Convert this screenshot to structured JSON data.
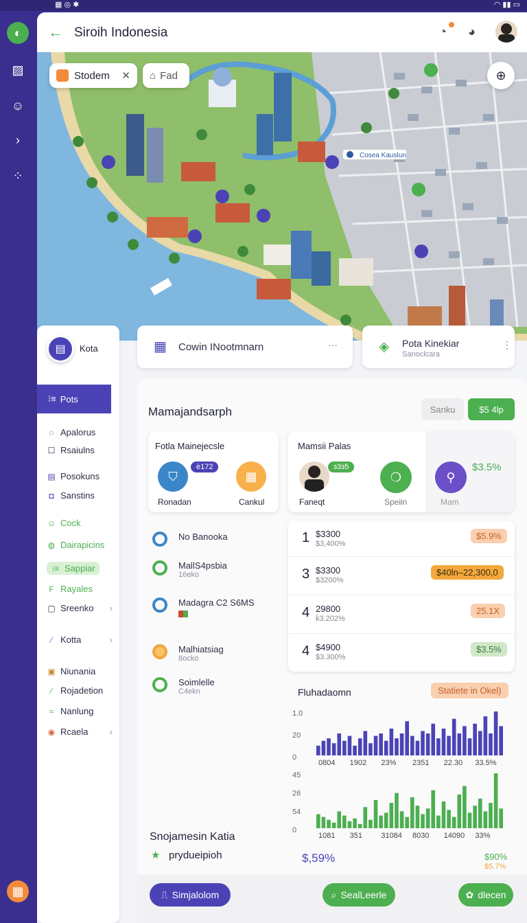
{
  "app": {
    "title": "Siroih Indonesia"
  },
  "map": {
    "search_chip": "Stodem",
    "filter_chip": "Fad",
    "label_1": "Cosea Kauslun"
  },
  "sidebar": {
    "header_label": "Kota",
    "active_item": "Pots",
    "items": [
      {
        "label": "Apalorus",
        "icon": "chat-icon"
      },
      {
        "label": "Rsaiulns",
        "icon": "edit-icon"
      },
      {
        "label": "Posokuns",
        "icon": "doc-icon"
      },
      {
        "label": "Sanstins",
        "icon": "square-icon"
      },
      {
        "label": "Cock",
        "icon": "smile-icon"
      },
      {
        "label": "Dairapicins",
        "icon": "globe-icon"
      },
      {
        "label": "Sappiar",
        "icon": "tag-icon"
      },
      {
        "label": "Rayales",
        "icon": "fz-icon"
      },
      {
        "label": "Sreenko",
        "icon": "square-icon"
      },
      {
        "label": "Kotta",
        "icon": "pen-icon"
      },
      {
        "label": "Niunania",
        "icon": "image-icon"
      },
      {
        "label": "Rojadetion",
        "icon": "leaf-icon"
      },
      {
        "label": "Nanlung",
        "icon": "wave-icon"
      },
      {
        "label": "Rcaela",
        "icon": "avatar-icon"
      }
    ]
  },
  "header_cards": {
    "left_title": "Cowin INootmnarn",
    "right_title": "Pota Kinekiar",
    "right_sub": "Sanoclcara"
  },
  "panel": {
    "title": "Mamajandsarph",
    "btn_secondary": "Sanku",
    "btn_primary": "$5 4lp",
    "card1": {
      "title": "Fotla Mainejecsle",
      "badge": "ė172",
      "item1": "Ronadan",
      "item2": "Cankul"
    },
    "card2": {
      "title": "Mamsii Palas",
      "badge": "ɜ3ɜ5",
      "item1": "Faneqt",
      "item2": "Speiin",
      "item3": "Mam",
      "value": "$3.5%"
    }
  },
  "list": [
    {
      "title": "No Banooka",
      "sub": "",
      "color": "#3a86c8"
    },
    {
      "title": "MallS4psbia",
      "sub": "16eko",
      "color": "#4caf50"
    },
    {
      "title": "Madagra C2 S6MS",
      "sub": "",
      "color": "#3a86c8"
    },
    {
      "title": "Malhiatsiag",
      "sub": "8ocko",
      "color": "#f0a640"
    },
    {
      "title": "Soimlelle",
      "sub": "C4ekn",
      "color": "#4caf50"
    }
  ],
  "ranking": [
    {
      "rank": "1",
      "value": "$3300",
      "sub": "$3,400%",
      "pill": "$5.9%",
      "pill_bg": "#f9cfae",
      "pill_color": "#c5602a"
    },
    {
      "rank": "3",
      "value": "$3300",
      "sub": "$3200%",
      "pill": "$40ln–22,300,0",
      "pill_bg": "#f2a83b",
      "pill_color": "#3b2a10"
    },
    {
      "rank": "4",
      "value": "29800",
      "sub": "ḱ3.202%",
      "pill": "25.1X",
      "pill_bg": "#f9cfae",
      "pill_color": "#c5602a"
    },
    {
      "rank": "4",
      "value": "$4900",
      "sub": "$3.300%",
      "pill": "$3.5%",
      "pill_bg": "#cfe8c8",
      "pill_color": "#3b7a3b"
    }
  ],
  "charts": {
    "title": "Fluhadaomn",
    "badge": "Statiete in Okel)",
    "footer_value_left": "$,59%",
    "footer_value_right_top": "$90%",
    "footer_value_right_bottom": "$5.7%"
  },
  "chart_data": [
    {
      "type": "bar",
      "yticks": [
        "1.0",
        "20",
        "0"
      ],
      "xticks": [
        "0804",
        "1902",
        "23%",
        "2351",
        "22.30",
        "33.5%"
      ],
      "values": [
        4,
        6,
        7,
        5,
        9,
        6,
        8,
        4,
        7,
        10,
        5,
        8,
        9,
        6,
        11,
        7,
        9,
        14,
        8,
        6,
        10,
        9,
        13,
        7,
        11,
        8,
        15,
        9,
        12,
        7,
        13,
        10,
        16,
        9,
        18,
        12
      ]
    },
    {
      "type": "bar",
      "yticks": [
        "45",
        "26",
        "54",
        "0"
      ],
      "xticks": [
        "1081",
        "351",
        "31084",
        "8030",
        "14090",
        "33%"
      ],
      "values": [
        10,
        8,
        6,
        4,
        12,
        9,
        5,
        7,
        3,
        15,
        6,
        20,
        9,
        11,
        18,
        25,
        12,
        8,
        22,
        16,
        10,
        14,
        27,
        9,
        19,
        13,
        8,
        24,
        30,
        11,
        16,
        21,
        12,
        18,
        39,
        14
      ]
    }
  ],
  "bottom": {
    "section_title": "Snojamesin Katia",
    "section_sub": "prydueipioh",
    "btn1": "Simjalolom",
    "btn2": "SealLeerle",
    "btn3": "dlecen"
  },
  "colors": {
    "primary": "#4b43b5",
    "green": "#4caf50",
    "orange": "#f2a83b"
  }
}
